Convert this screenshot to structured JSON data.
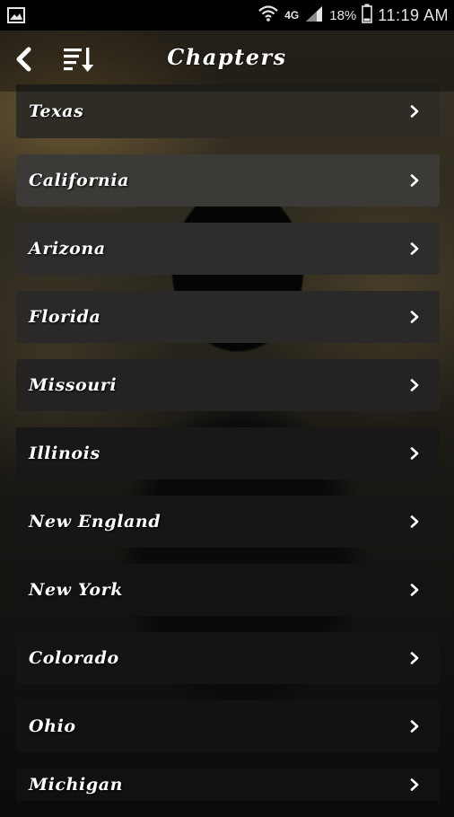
{
  "status_bar": {
    "network": "4G",
    "battery": "18%",
    "time": "11:19 AM",
    "icons": [
      "gallery-icon",
      "wifi-icon",
      "signal-icon",
      "battery-icon"
    ]
  },
  "toolbar": {
    "title": "Chapters",
    "back_icon": "back-arrow-icon",
    "sort_icon": "sort-icon"
  },
  "chapters": [
    {
      "label": "Texas",
      "bg": "#2f2c26"
    },
    {
      "label": "California",
      "bg": "#3b3a37"
    },
    {
      "label": "Arizona",
      "bg": "#2e2d2b"
    },
    {
      "label": "Florida",
      "bg": "#2a2927"
    },
    {
      "label": "Missouri",
      "bg": "#242322"
    },
    {
      "label": "Illinois",
      "bg": "#181818"
    },
    {
      "label": "New England",
      "bg": "#161616"
    },
    {
      "label": "New York",
      "bg": "#131313"
    },
    {
      "label": "Colorado",
      "bg": "#141414"
    },
    {
      "label": "Ohio",
      "bg": "#121212"
    },
    {
      "label": "Michigan",
      "bg": "#111111"
    }
  ]
}
